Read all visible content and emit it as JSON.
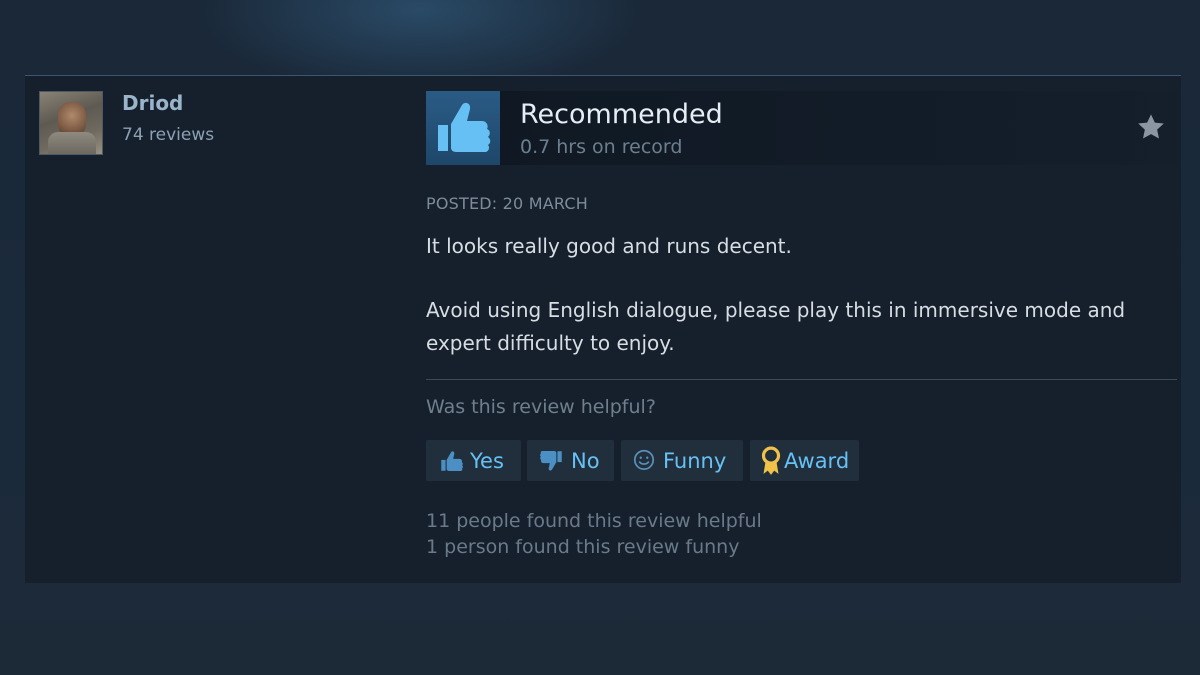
{
  "author": {
    "name": "Driod",
    "review_count": "74 reviews"
  },
  "review": {
    "verdict": "Recommended",
    "hours": "0.7 hrs on record",
    "posted": "POSTED: 20 MARCH",
    "paragraphs": [
      "It looks really good and runs decent.",
      "Avoid using English dialogue, please play this in immersive mode and expert difficulty to enjoy."
    ],
    "helpful_question": "Was this review helpful?",
    "buttons": {
      "yes": "Yes",
      "no": "No",
      "funny": "Funny",
      "award": "Award"
    },
    "stats": {
      "helpful": "11 people found this review helpful",
      "funny": "1 person found this review funny"
    }
  },
  "icons": {
    "verdict": "thumbs-up-icon",
    "favorite": "star-icon",
    "yes": "thumbs-up-icon",
    "no": "thumbs-down-icon",
    "funny": "smiley-icon",
    "award": "award-ribbon-icon"
  },
  "colors": {
    "page_bg": "#1b2838",
    "card_bg": "#16202d",
    "link_blue": "#67c1f5",
    "thumb_bg": "#2a5b85",
    "award_gold": "#f0c24a"
  }
}
